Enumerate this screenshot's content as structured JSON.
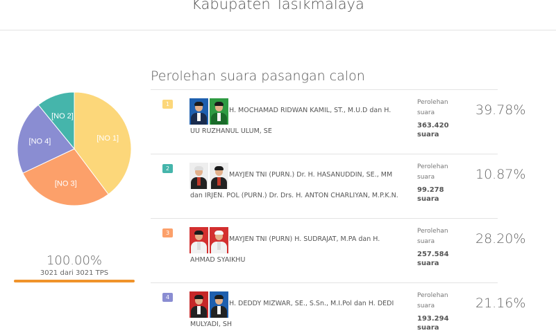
{
  "header": {
    "title": "Kabupaten Tasikmalaya"
  },
  "colors": {
    "c1": "#fcd77a",
    "c2": "#45b5ab",
    "c3": "#fca06a",
    "c4": "#8a8dd2",
    "progress": "#f0932b"
  },
  "chart_data": {
    "type": "pie",
    "labels": [
      "[NO 1]",
      "[NO 2]",
      "[NO 3]",
      "[NO 4]"
    ],
    "values": [
      39.78,
      10.87,
      28.2,
      21.16
    ]
  },
  "progress": {
    "percent_text": "100.00%",
    "sub_text": "3021 dari 3021 TPS",
    "value": 100
  },
  "section": {
    "title": "Perolehan suara pasangan calon"
  },
  "candidates": [
    {
      "no": "1",
      "name_line1": "H. MOCHAMAD RIDWAN KAMIL, ST., M.U.D dan H.",
      "name_line2": "UU RUZHANUL ULUM, SE",
      "caption1": "Perolehan",
      "caption2": "suara",
      "votes": "363.420",
      "unit": "suara",
      "percent": "39.78%"
    },
    {
      "no": "2",
      "name_line1": "MAYJEN TNI (PURN.) Dr. H. HASANUDDIN, SE., MM",
      "name_line2": "dan IRJEN. POL (PURN.) Dr. Drs. H. ANTON CHARLIYAN, M.P.K.N.",
      "caption1": "Perolehan",
      "caption2": "suara",
      "votes": "99.278",
      "unit": "suara",
      "percent": "10.87%"
    },
    {
      "no": "3",
      "name_line1": "MAYJEN TNI (PURN) H. SUDRAJAT, M.PA dan H.",
      "name_line2": "AHMAD SYAIKHU",
      "caption1": "Perolehan",
      "caption2": "suara",
      "votes": "257.584",
      "unit": "suara",
      "percent": "28.20%"
    },
    {
      "no": "4",
      "name_line1": "H. DEDDY MIZWAR, SE., S.Sn., M.I.Pol dan H. DEDI",
      "name_line2": "MULYADI, SH",
      "caption1": "Perolehan",
      "caption2": "suara",
      "votes": "193.294",
      "unit": "suara",
      "percent": "21.16%"
    }
  ]
}
